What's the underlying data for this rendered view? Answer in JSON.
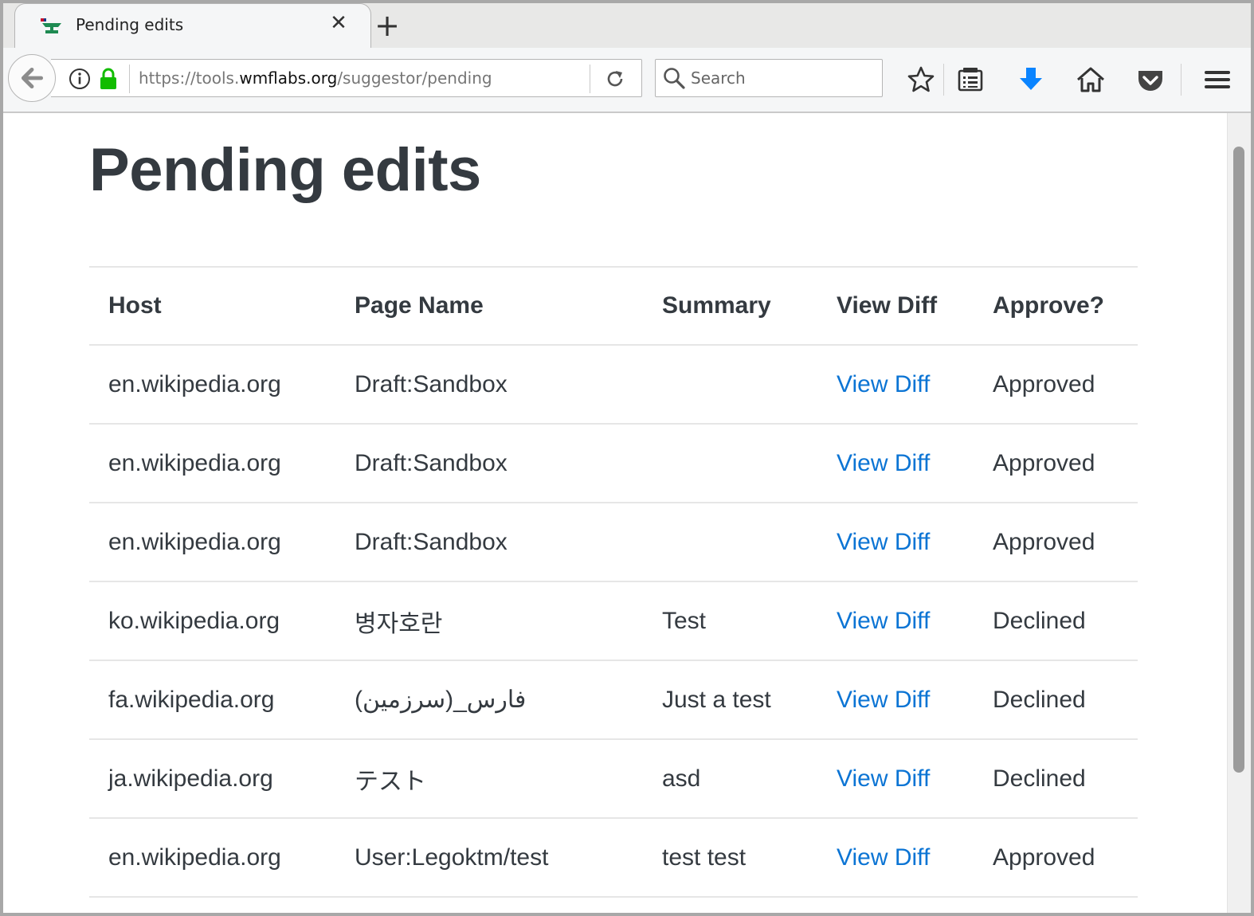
{
  "browser": {
    "tab_title": "Pending edits",
    "new_tab_label": "+",
    "close_tab_label": "✕",
    "url_prefix": "https://tools.",
    "url_domain": "wmflabs.org",
    "url_path": "/suggestor/pending",
    "search_placeholder": "Search"
  },
  "page": {
    "title": "Pending edits"
  },
  "table": {
    "headers": {
      "host": "Host",
      "page_name": "Page Name",
      "summary": "Summary",
      "view_diff": "View Diff",
      "approve": "Approve?"
    },
    "rows": [
      {
        "host": "en.wikipedia.org",
        "page_name": "Draft:Sandbox",
        "summary": "",
        "diff": "View Diff",
        "status": "Approved"
      },
      {
        "host": "en.wikipedia.org",
        "page_name": "Draft:Sandbox",
        "summary": "",
        "diff": "View Diff",
        "status": "Approved"
      },
      {
        "host": "en.wikipedia.org",
        "page_name": "Draft:Sandbox",
        "summary": "",
        "diff": "View Diff",
        "status": "Approved"
      },
      {
        "host": "ko.wikipedia.org",
        "page_name": "병자호란",
        "summary": "Test",
        "diff": "View Diff",
        "status": "Declined"
      },
      {
        "host": "fa.wikipedia.org",
        "page_name": "فارس_(سرزمین)",
        "summary": "Just a test",
        "diff": "View Diff",
        "status": "Declined"
      },
      {
        "host": "ja.wikipedia.org",
        "page_name": "テスト",
        "summary": "asd",
        "diff": "View Diff",
        "status": "Declined"
      },
      {
        "host": "en.wikipedia.org",
        "page_name": "User:Legoktm/test",
        "summary": "test test",
        "diff": "View Diff",
        "status": "Approved"
      }
    ]
  },
  "colors": {
    "link": "#0b74d4",
    "heading": "#343a40",
    "download_icon": "#0a84ff",
    "lock_icon": "#12bc00"
  },
  "icons": {
    "favicon": "anvil-favicon-icon",
    "back": "back-arrow-icon",
    "info": "info-icon",
    "lock": "lock-icon",
    "reload": "reload-icon",
    "search": "search-icon",
    "bookmark": "star-icon",
    "reader": "reading-list-icon",
    "download": "download-icon",
    "home": "home-icon",
    "pocket": "pocket-icon",
    "menu": "hamburger-menu-icon"
  }
}
